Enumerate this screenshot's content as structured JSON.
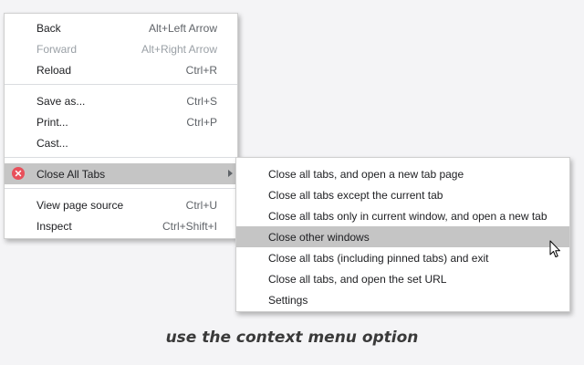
{
  "context_menu": {
    "items": [
      {
        "label": "Back",
        "shortcut": "Alt+Left Arrow"
      },
      {
        "label": "Forward",
        "shortcut": "Alt+Right Arrow",
        "disabled": true
      },
      {
        "label": "Reload",
        "shortcut": "Ctrl+R"
      },
      {
        "label": "Save as...",
        "shortcut": "Ctrl+S"
      },
      {
        "label": "Print...",
        "shortcut": "Ctrl+P"
      },
      {
        "label": "Cast...",
        "shortcut": ""
      },
      {
        "label": "Close All Tabs",
        "shortcut": "",
        "icon": "close-circle-icon",
        "has_submenu": true,
        "highlighted": true
      },
      {
        "label": "View page source",
        "shortcut": "Ctrl+U"
      },
      {
        "label": "Inspect",
        "shortcut": "Ctrl+Shift+I"
      }
    ]
  },
  "submenu": {
    "items": [
      {
        "label": "Close all tabs, and open a new tab page"
      },
      {
        "label": "Close all tabs except the current tab"
      },
      {
        "label": "Close all tabs only in current window, and open a new tab"
      },
      {
        "label": "Close other windows",
        "highlighted": true
      },
      {
        "label": "Close all tabs (including pinned tabs) and exit"
      },
      {
        "label": "Close all tabs, and open the set URL"
      },
      {
        "label": "Settings"
      }
    ]
  },
  "caption": "use the context menu option",
  "colors": {
    "highlight": "#c5c5c5",
    "icon_red": "#e8505b",
    "background": "#f4f4f6"
  }
}
